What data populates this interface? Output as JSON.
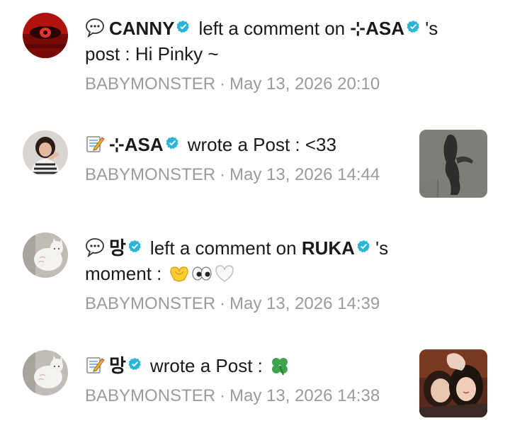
{
  "notifications": [
    {
      "icon": "speech-bubble-icon",
      "actor": "CANNY",
      "action": "left a comment on",
      "target": "⊹ASA",
      "suffix": "'s",
      "line2": "post : Hi Pinky ~",
      "group": "BABYMONSTER",
      "separator": "·",
      "timestamp": "May 13, 2026 20:10"
    },
    {
      "icon": "memo-icon",
      "actor": "⊹ASA",
      "action": "wrote a Post : <33",
      "group": "BABYMONSTER",
      "separator": "·",
      "timestamp": "May 13, 2026 14:44"
    },
    {
      "icon": "speech-bubble-icon",
      "actor": "망",
      "action": "left a comment on",
      "target": "RUKA",
      "suffix": "'s",
      "line2": "moment :",
      "line2_emojis": [
        "heart-hands-emoji",
        "eyes-emoji",
        "white-heart-emoji"
      ],
      "group": "BABYMONSTER",
      "separator": "·",
      "timestamp": "May 13, 2026 14:39"
    },
    {
      "icon": "memo-icon",
      "actor": "망",
      "action": "wrote a Post :",
      "action_emoji": "four-leaf-clover-emoji",
      "group": "BABYMONSTER",
      "separator": "·",
      "timestamp": "May 13, 2026 14:38"
    }
  ],
  "colors": {
    "verified": "#28b5d8",
    "meta_text": "#9b9b9b",
    "primary_text": "#1a1a1a"
  }
}
